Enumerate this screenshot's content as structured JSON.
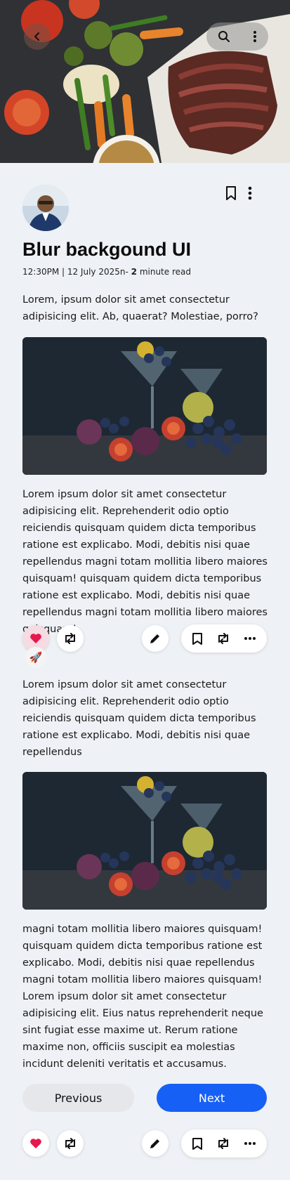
{
  "hero": {
    "back_icon": "chevron-left-icon",
    "search_icon": "search-icon",
    "more_icon": "more-vertical-icon"
  },
  "article": {
    "title": "Blur backgound UI",
    "meta_time_date": "12:30PM | 12 July 2025n-",
    "meta_minutes": "2",
    "meta_suffix": "minute read",
    "intro": "Lorem, ipsum dolor sit amet consectetur adipisicing elit. Ab, quaerat? Molestiae, porro?",
    "para1": "Lorem ipsum dolor sit amet consectetur adipisicing elit. Reprehenderit odio optio reiciendis quisquam quidem dicta temporibus ratione est explicabo. Modi, debitis nisi quae repellendus magni totam mollitia libero maiores quisquam! quisquam quidem dicta temporibus ratione est explicabo. Modi, debitis nisi quae repellendus magni totam mollitia libero maiores quisquam!",
    "para2": "Lorem ipsum dolor sit amet consectetur adipisicing elit. Reprehenderit odio optio reiciendis quisquam quidem dicta temporibus ratione est explicabo. Modi, debitis nisi quae repellendus",
    "para3": "magni totam mollitia libero maiores quisquam! quisquam quidem dicta temporibus ratione est explicabo. Modi, debitis nisi quae repellendus magni totam mollitia libero maiores quisquam! Lorem ipsum dolor sit amet consectetur adipisicing elit. Eius natus reprehenderit neque sint fugiat esse maxime ut. Rerum ratione maxime non, officiis suscipit ea molestias incidunt deleniti veritatis et accusamus."
  },
  "actions": {
    "icons": [
      "heart-icon",
      "repost-icon",
      "edit-icon",
      "bookmark-icon",
      "repost-icon",
      "more-horizontal-icon",
      "rocket-icon"
    ],
    "rocket_emoji": "🚀"
  },
  "pagination": {
    "previous_label": "Previous",
    "next_label": "Next"
  },
  "colors": {
    "accent": "#1760f5",
    "like": "#e8174e",
    "background": "#eef1f5"
  }
}
